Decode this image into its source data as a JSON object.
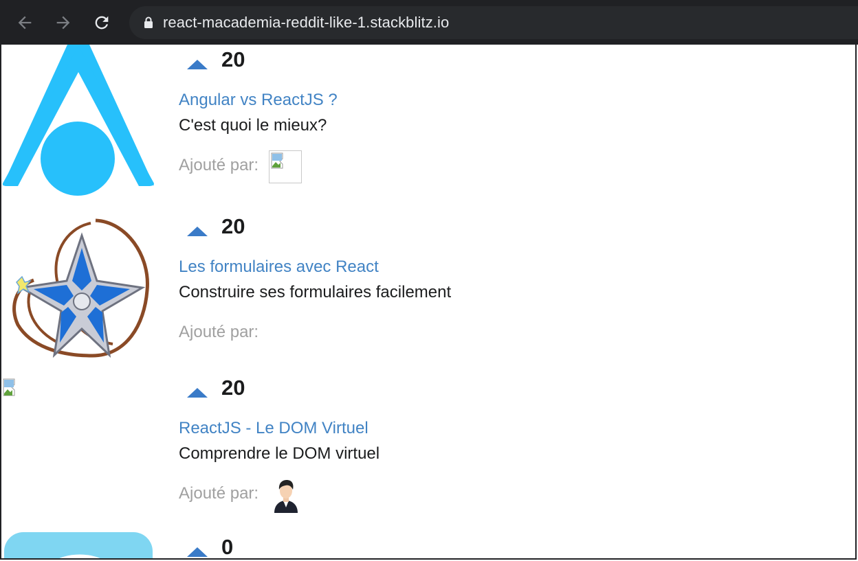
{
  "browser": {
    "url": "react-macademia-reddit-like-1.stackblitz.io",
    "back_icon": "arrow-left-icon",
    "forward_icon": "arrow-right-icon",
    "reload_icon": "reload-icon",
    "lock_icon": "lock-icon"
  },
  "colors": {
    "accent_link": "#4183c4",
    "vote_arrow": "#3a7bc8",
    "muted_text": "#a0a0a0",
    "browser_chrome": "#202124"
  },
  "posts": [
    {
      "votes": "20",
      "title": "Angular vs ReactJS ?",
      "description": "C'est quoi le mieux?",
      "added_by_label": "Ajouté par:",
      "thumbnail_icon": "angular-a-logo-icon",
      "avatar": "broken-image-icon"
    },
    {
      "votes": "20",
      "title": "Les formulaires avec React",
      "description": "Construire ses formulaires facilement",
      "added_by_label": "Ajouté par:",
      "thumbnail_icon": "star-pendant-icon",
      "avatar": ""
    },
    {
      "votes": "20",
      "title": "ReactJS - Le DOM Virtuel",
      "description": "Comprendre le DOM virtuel",
      "added_by_label": "Ajouté par:",
      "thumbnail_icon": "broken-image-icon",
      "avatar": "user-avatar-icon"
    },
    {
      "votes": "0",
      "thumbnail_icon": "app-logo-icon"
    }
  ]
}
